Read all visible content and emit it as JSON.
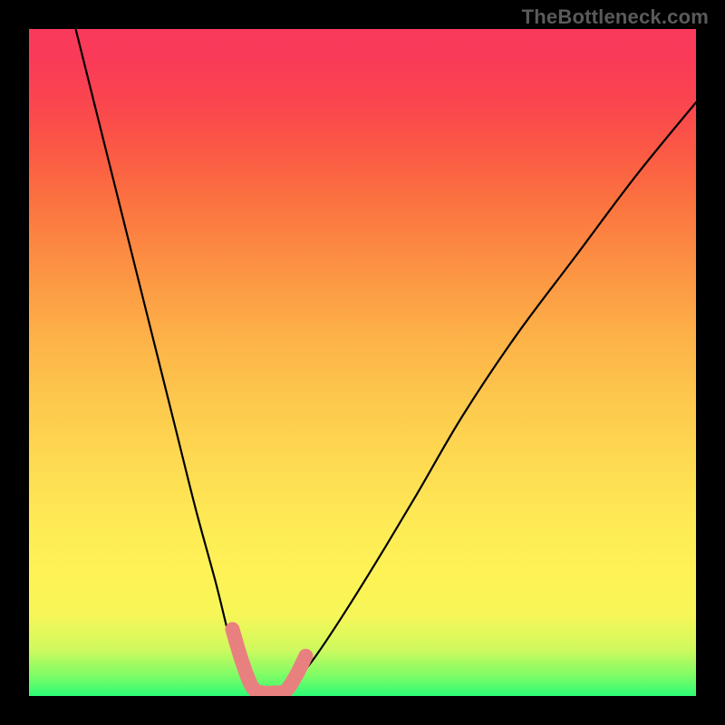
{
  "watermark": "TheBottleneck.com",
  "colors": {
    "bg": "#000000",
    "marker": "#e98080",
    "curve": "#000000"
  },
  "chart_data": {
    "type": "line",
    "title": "",
    "xlabel": "",
    "ylabel": "",
    "xlim": [
      0,
      100
    ],
    "ylim": [
      0,
      100
    ],
    "grid": false,
    "legend": null,
    "series": [
      {
        "name": "left-branch",
        "x": [
          7,
          10,
          13,
          16,
          19,
          22,
          25,
          28,
          30,
          31.5,
          33,
          34
        ],
        "y": [
          100,
          88,
          76,
          64,
          52,
          40,
          28,
          17,
          9,
          4.5,
          1,
          0
        ]
      },
      {
        "name": "right-branch",
        "x": [
          38,
          40,
          43,
          47,
          52,
          58,
          65,
          73,
          82,
          91,
          100
        ],
        "y": [
          0,
          2.2,
          6,
          12,
          20,
          30,
          42,
          54,
          66,
          78,
          89
        ]
      }
    ],
    "marker": {
      "name": "low-bottleneck-zone",
      "points": [
        {
          "x": 30.5,
          "y": 10
        },
        {
          "x": 32.0,
          "y": 5
        },
        {
          "x": 33.5,
          "y": 1.3
        },
        {
          "x": 35.0,
          "y": 0.5
        },
        {
          "x": 37.0,
          "y": 0.5
        },
        {
          "x": 38.5,
          "y": 0.8
        },
        {
          "x": 40.0,
          "y": 3
        },
        {
          "x": 41.5,
          "y": 6
        }
      ]
    }
  }
}
